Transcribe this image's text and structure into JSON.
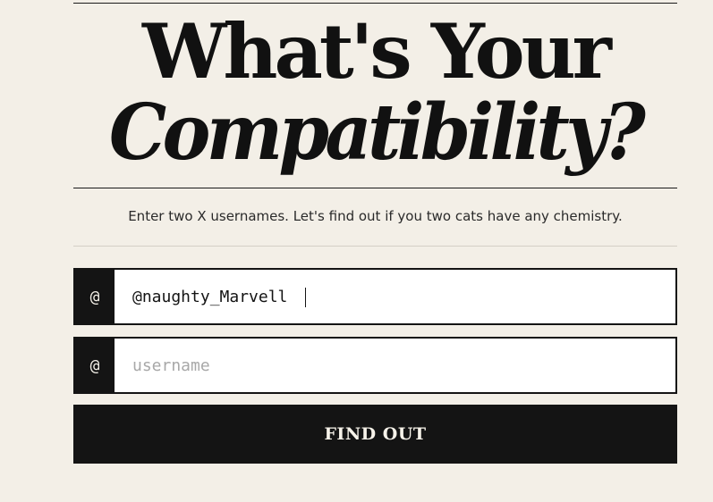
{
  "header": {
    "title_line1": "What's Your",
    "title_line2": "Compatibility?",
    "subtitle": "Enter two X usernames. Let's find out if you two cats have any chemistry."
  },
  "form": {
    "prefix_symbol": "@",
    "username1": {
      "value": "@naughty_Marvell",
      "placeholder": "username"
    },
    "username2": {
      "value": "",
      "placeholder": "username"
    },
    "submit_label": "FIND OUT"
  }
}
